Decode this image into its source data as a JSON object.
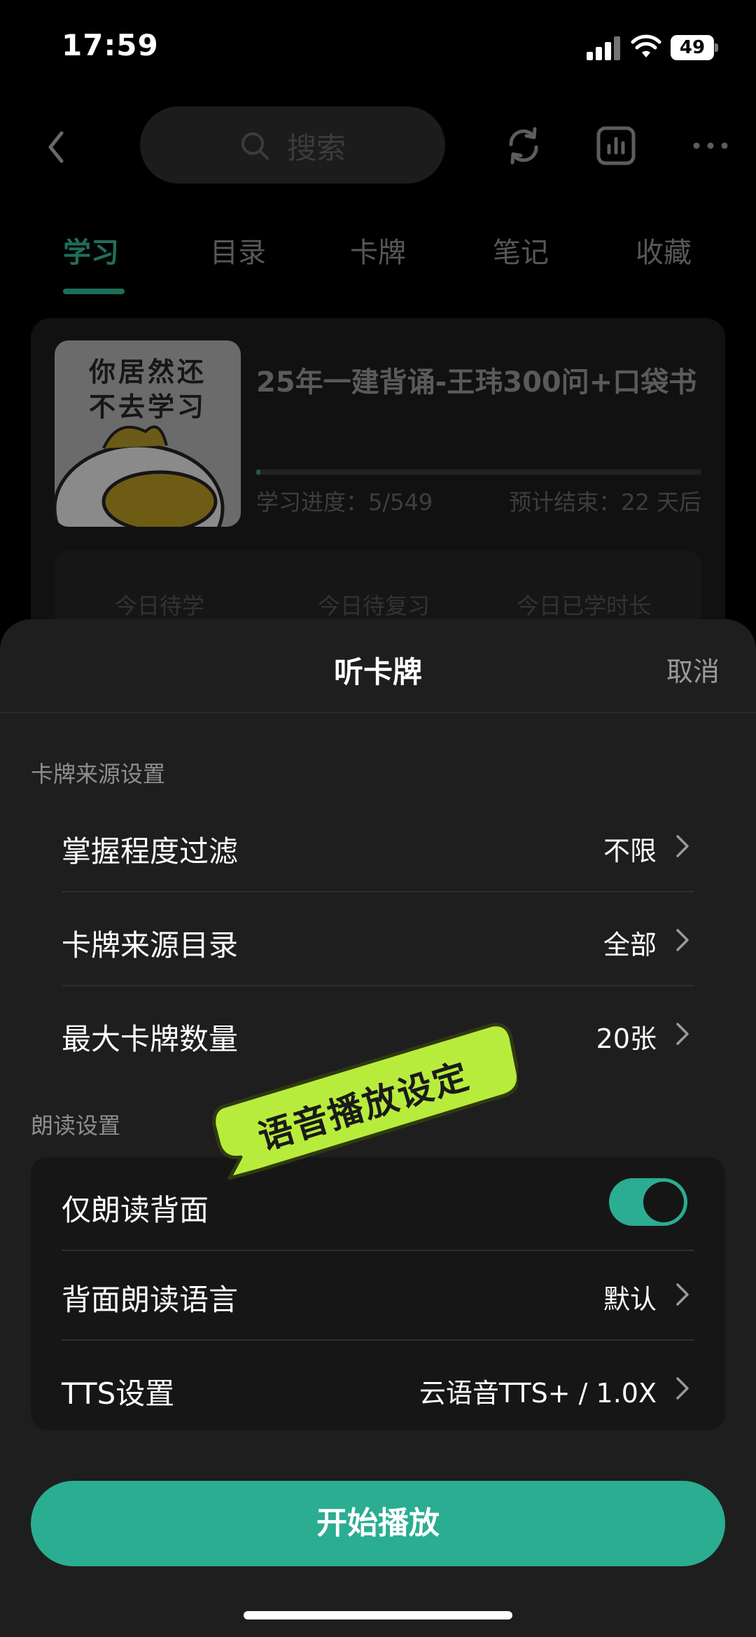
{
  "status_bar": {
    "time": "17:59",
    "battery": "49"
  },
  "background_app": {
    "search_placeholder": "搜索",
    "icons": [
      "back-chevron-icon",
      "search-icon",
      "refresh-icon",
      "stats-icon",
      "more-icon"
    ],
    "tabs": [
      {
        "label": "学习",
        "active": true
      },
      {
        "label": "目录",
        "active": false
      },
      {
        "label": "卡牌",
        "active": false
      },
      {
        "label": "笔记",
        "active": false
      },
      {
        "label": "收藏",
        "active": false
      }
    ],
    "course": {
      "cover_lines": [
        "你居然还",
        "不去学习"
      ],
      "title": "25年一建背诵-王玮300问+口袋书",
      "progress_text": "学习进度：5/549",
      "progress_fraction": 0.009,
      "eta_text": "预计结束：22 天后"
    },
    "stats": [
      "今日待学",
      "今日待复习",
      "今日已学时长"
    ]
  },
  "sheet": {
    "title": "听卡牌",
    "cancel_label": "取消",
    "source_section": {
      "label": "卡牌来源设置",
      "rows": [
        {
          "label": "掌握程度过滤",
          "value": "不限"
        },
        {
          "label": "卡牌来源目录",
          "value": "全部"
        },
        {
          "label": "最大卡牌数量",
          "value": "20张"
        }
      ]
    },
    "reading_section": {
      "label": "朗读设置",
      "back_only": {
        "label": "仅朗读背面",
        "on": true
      },
      "rows": [
        {
          "label": "背面朗读语言",
          "value": "默认"
        },
        {
          "label": "TTS设置",
          "value": "云语音TTS+ / 1.0X"
        }
      ]
    },
    "start_button": "开始播放"
  },
  "sticker": {
    "text": "语音播放设定",
    "color": "#b8ec3c"
  },
  "colors": {
    "accent": "#2bad92",
    "sheet_bg": "#1e1e1e"
  }
}
